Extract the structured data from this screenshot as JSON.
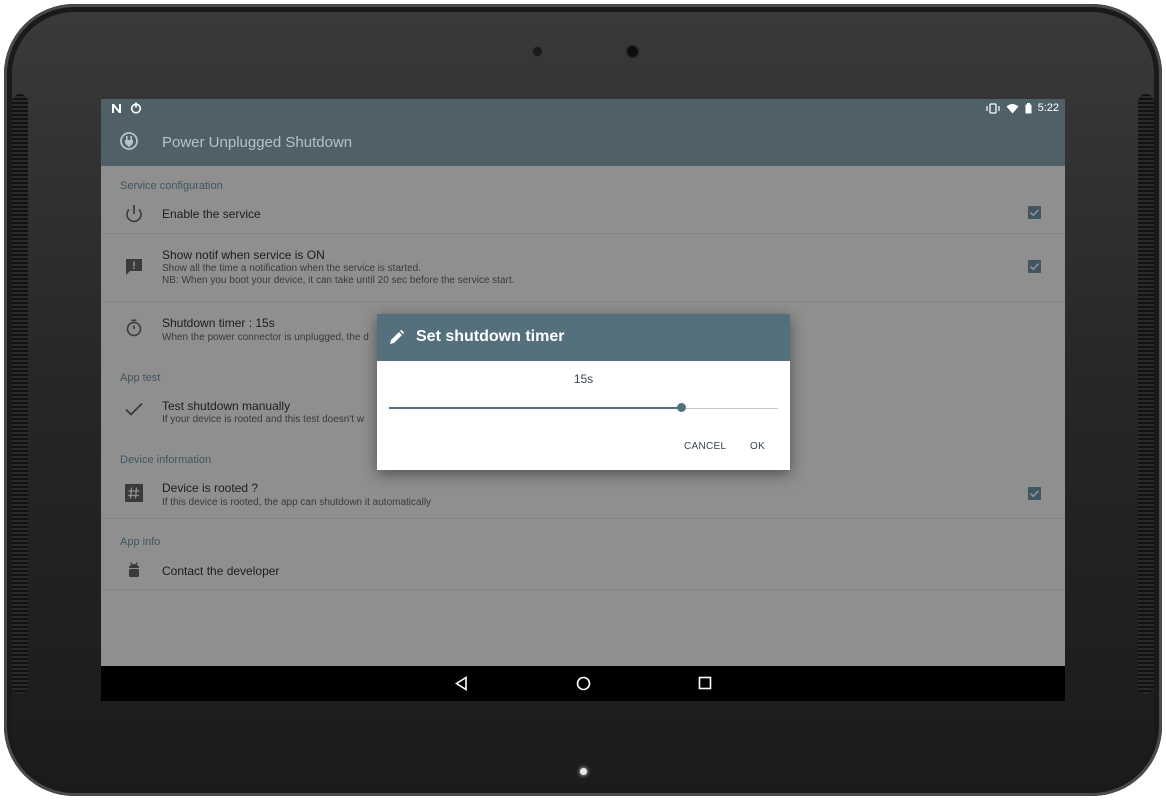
{
  "status_bar": {
    "time": "5:22"
  },
  "app_bar": {
    "title": "Power Unplugged Shutdown"
  },
  "sections": {
    "service_configuration": "Service configuration",
    "app_test": "App test",
    "device_information": "Device information",
    "app_info": "App info"
  },
  "prefs": {
    "enable_service": {
      "title": "Enable the service",
      "checked": true
    },
    "show_notif": {
      "title": "Show notif when service is ON",
      "summary_1": "Show all the time a notification when the service is started.",
      "summary_2": "NB: When you boot your device, it can take until 20 sec before the service start.",
      "checked": true
    },
    "shutdown_timer": {
      "title": "Shutdown timer : 15s",
      "summary": "When the power connector is unplugged, the d"
    },
    "test_shutdown": {
      "title": "Test shutdown manually",
      "summary": "If your device is rooted and this test doesn't w"
    },
    "device_rooted": {
      "title": "Device is rooted ?",
      "summary": "If this device is rooted, the app can shutdown it automatically",
      "checked": true
    },
    "contact": {
      "title": "Contact the developer"
    }
  },
  "dialog": {
    "title": "Set shutdown timer",
    "value_label": "15s",
    "slider_fraction": 0.75,
    "cancel_label": "CANCEL",
    "ok_label": "OK"
  },
  "colors": {
    "primary": "#55707d",
    "status_bar": "#4f6069",
    "accent": "#3f5561"
  },
  "icons": [
    "notification-n-icon",
    "power-icon",
    "vibrate-icon",
    "wifi-icon",
    "battery-icon",
    "power-plug-icon",
    "power-button-icon",
    "feedback-icon",
    "timer-icon",
    "check-icon",
    "hash-icon",
    "android-icon",
    "pencil-icon",
    "back-icon",
    "home-icon",
    "recents-icon"
  ]
}
